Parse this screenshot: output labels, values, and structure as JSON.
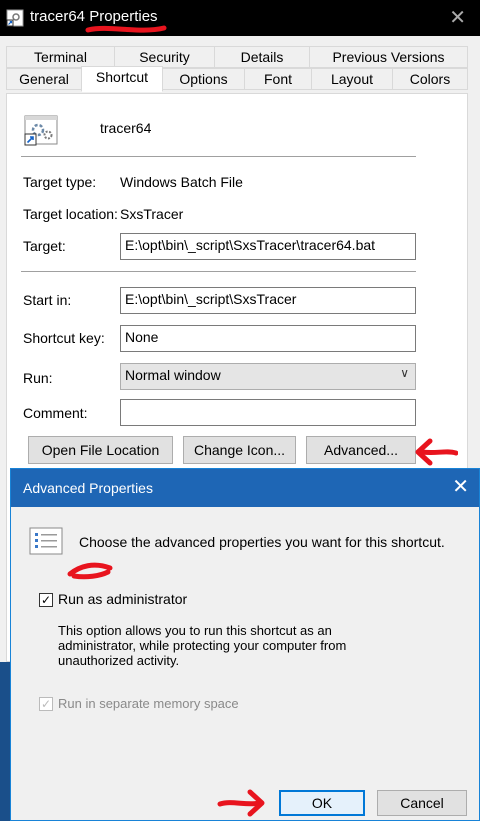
{
  "window": {
    "title": "tracer64 Properties",
    "close_glyph": "✕"
  },
  "tabs_row_top": [
    "Terminal",
    "Security",
    "Details",
    "Previous Versions"
  ],
  "tabs_row_bottom": [
    "General",
    "Shortcut",
    "Options",
    "Font",
    "Layout",
    "Colors"
  ],
  "active_tab": "Shortcut",
  "shortcut": {
    "name": "tracer64",
    "target_type_label": "Target type:",
    "target_type_value": "Windows Batch File",
    "target_location_label": "Target location:",
    "target_location_value": "SxsTracer",
    "target_label": "Target:",
    "target_value": "E:\\opt\\bin\\_script\\SxsTracer\\tracer64.bat",
    "start_in_label": "Start in:",
    "start_in_value": "E:\\opt\\bin\\_script\\SxsTracer",
    "shortcut_key_label": "Shortcut key:",
    "shortcut_key_value": "None",
    "run_label": "Run:",
    "run_value": "Normal window",
    "comment_label": "Comment:",
    "comment_value": "",
    "buttons": {
      "open_location": "Open File Location",
      "change_icon": "Change Icon...",
      "advanced": "Advanced..."
    }
  },
  "advanced_dialog": {
    "title": "Advanced Properties",
    "close_glyph": "✕",
    "intro": "Choose the advanced properties you want for this shortcut.",
    "run_as_admin_label": "Run as administrator",
    "run_as_admin_checked": true,
    "description": "This option allows you to run this shortcut as an administrator, while protecting your computer from unauthorized activity.",
    "separate_memory_label": "Run in separate memory space",
    "separate_memory_checked": true,
    "separate_memory_enabled": false,
    "ok_label": "OK",
    "cancel_label": "Cancel"
  },
  "colors": {
    "annotation_red": "#e8141e",
    "dialog_title_blue": "#1e66b5",
    "focus_blue": "#0078d7"
  }
}
